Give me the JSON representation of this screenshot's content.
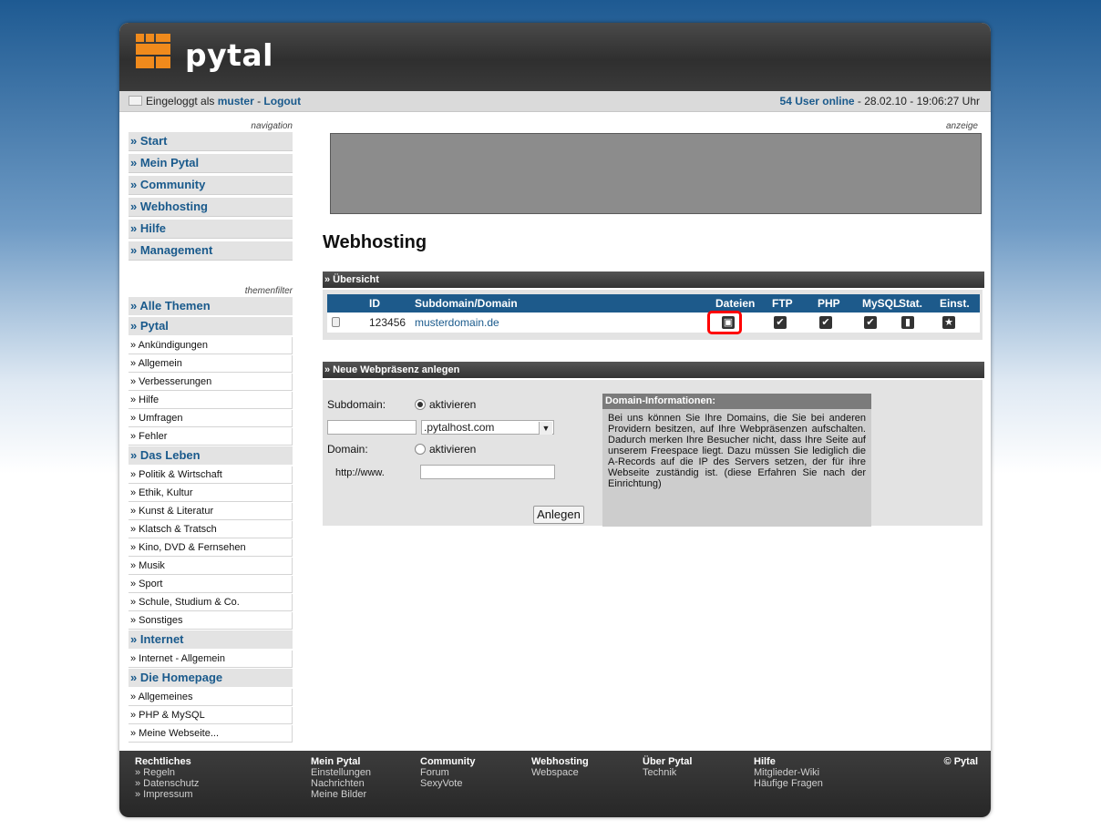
{
  "brand": {
    "name": "pytal",
    "accent": "#f08a1c"
  },
  "status": {
    "logged_in_prefix": "Eingeloggt als",
    "username": "muster",
    "separator": " - ",
    "logout": "Logout",
    "online_count": "54 User online",
    "datetime": " - 28.02.10 - 19:06:27 Uhr"
  },
  "nav": {
    "caption": "navigation",
    "items": [
      "» Start",
      "» Mein Pytal",
      "» Community",
      "» Webhosting",
      "» Hilfe",
      "» Management"
    ]
  },
  "themes": {
    "caption": "themenfilter",
    "all": "» Alle Themen",
    "groups": [
      {
        "label": "» Pytal",
        "items": [
          "» Ankündigungen",
          "» Allgemein",
          "» Verbesserungen",
          "» Hilfe",
          "» Umfragen",
          "» Fehler"
        ]
      },
      {
        "label": "» Das Leben",
        "items": [
          "» Politik & Wirtschaft",
          "» Ethik, Kultur",
          "» Kunst & Literatur",
          "» Klatsch & Tratsch",
          "» Kino, DVD & Fernsehen",
          "» Musik",
          "» Sport",
          "» Schule, Studium & Co.",
          "» Sonstiges"
        ]
      },
      {
        "label": "» Internet",
        "items": [
          "» Internet - Allgemein"
        ]
      },
      {
        "label": "» Die Homepage",
        "items": [
          "» Allgemeines",
          "» PHP & MySQL",
          "» Meine Webseite..."
        ]
      }
    ]
  },
  "ad": {
    "caption": "anzeige"
  },
  "page_title": "Webhosting",
  "overview": {
    "title": "» Übersicht",
    "columns": {
      "id": "ID",
      "domain": "Subdomain/Domain",
      "files": "Dateien",
      "ftp": "FTP",
      "php": "PHP",
      "mysql": "MySQL",
      "stat": "Stat.",
      "settings": "Einst."
    },
    "rows": [
      {
        "id": "123456",
        "domain": "musterdomain.de"
      }
    ]
  },
  "new_site": {
    "title": "» Neue Webpräsenz anlegen",
    "subdomain_label": "Subdomain:",
    "activate": "aktivieren",
    "subdomain_value": "",
    "host_option": ".pytalhost.com",
    "domain_label": "Domain:",
    "http_prefix": "http://www.",
    "domain_value": "",
    "create_button": "Anlegen"
  },
  "domain_info": {
    "title": "Domain-Informationen:",
    "text": "Bei uns können Sie Ihre Domains, die Sie bei anderen Providern besitzen, auf Ihre Webpräsenzen aufschalten. Dadurch merken Ihre Besucher nicht, dass Ihre Seite auf unserem Freespace liegt. Dazu müssen Sie lediglich die A-Records auf die IP des Servers setzen, der für ihre Webseite zuständig ist. (diese Erfahren Sie nach der Einrichtung)"
  },
  "footer": {
    "columns": [
      {
        "heading": "Rechtliches",
        "links": [
          "» Regeln",
          "» Datenschutz",
          "» Impressum"
        ]
      },
      {
        "heading": "Mein Pytal",
        "links": [
          "Einstellungen",
          "Nachrichten",
          "Meine Bilder"
        ]
      },
      {
        "heading": "Community",
        "links": [
          "Forum",
          "SexyVote"
        ]
      },
      {
        "heading": "Webhosting",
        "links": [
          "Webspace"
        ]
      },
      {
        "heading": "Über Pytal",
        "links": [
          "Technik"
        ]
      },
      {
        "heading": "Hilfe",
        "links": [
          "Mitglieder-Wiki",
          "Häufige Fragen"
        ]
      }
    ],
    "copyright": "© Pytal"
  }
}
